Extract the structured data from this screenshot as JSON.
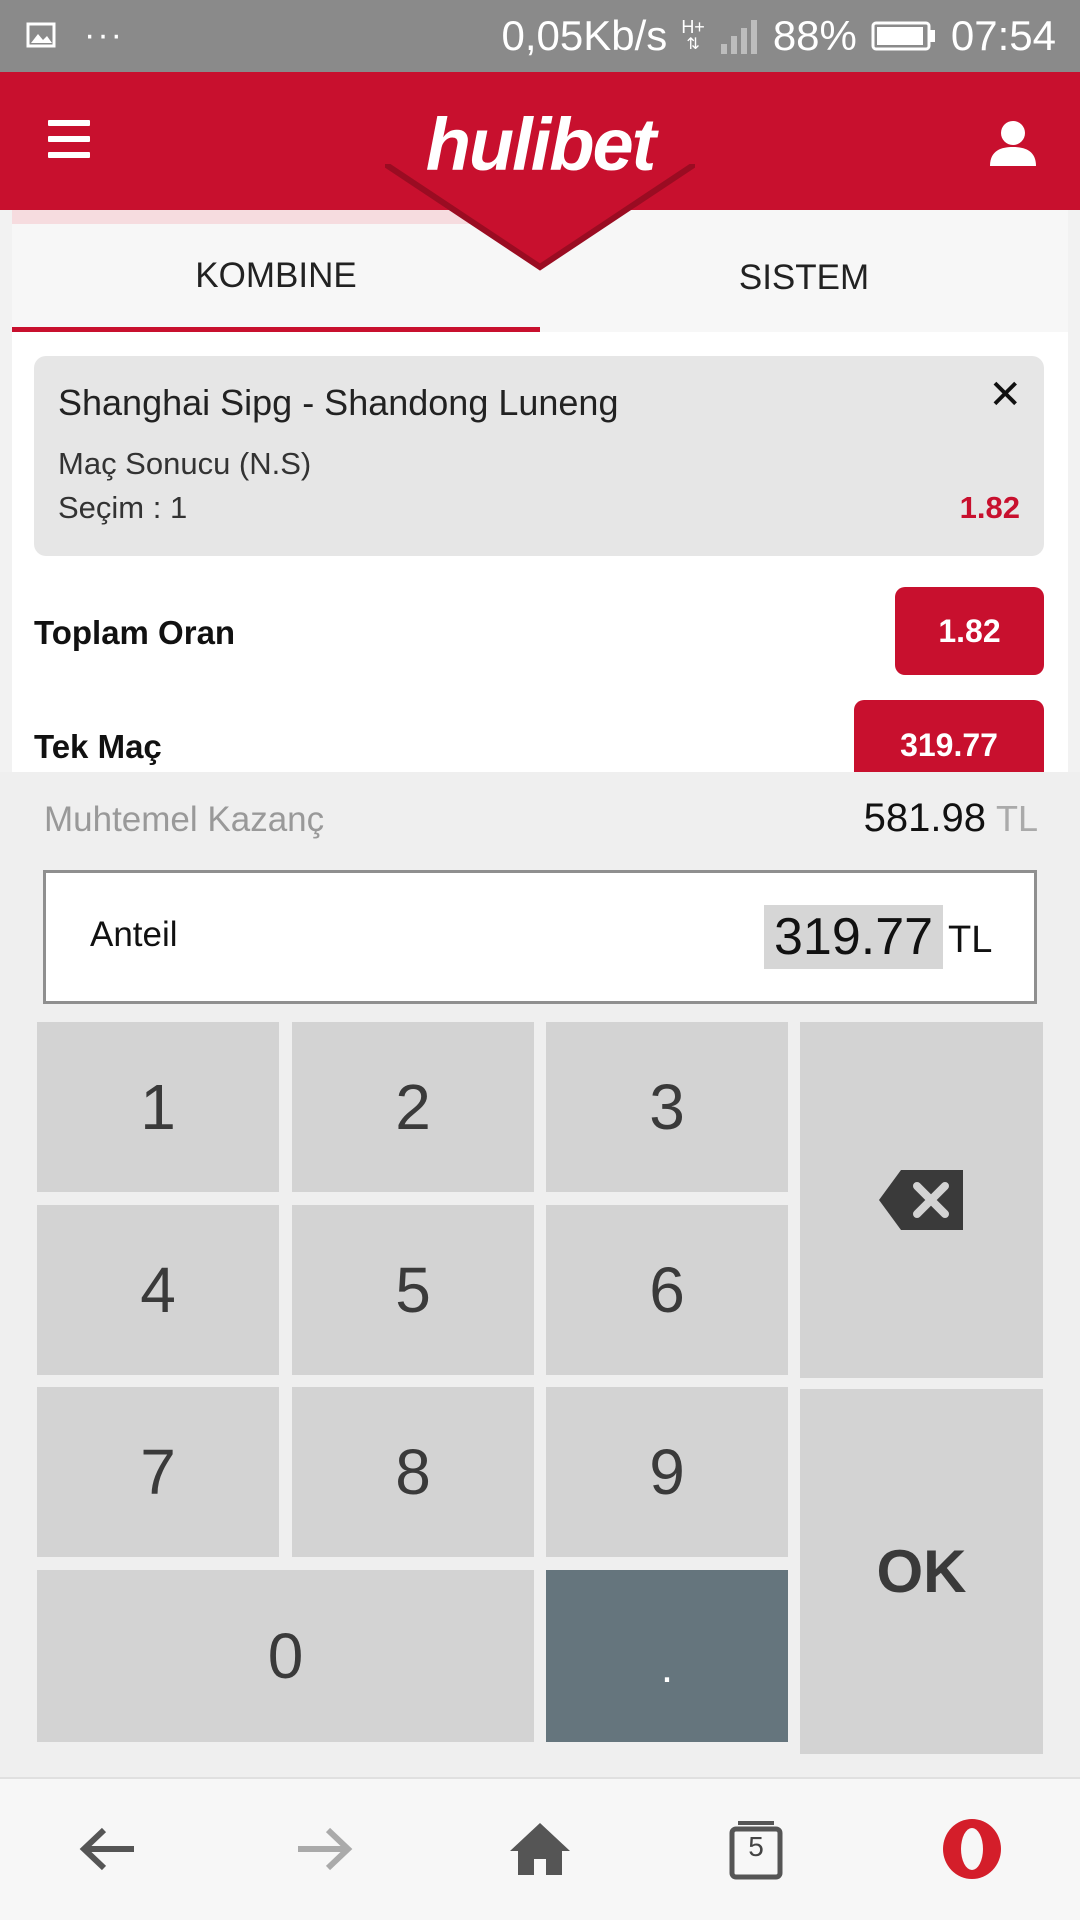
{
  "status_bar": {
    "speed": "0,05Kb/s",
    "network": "H+",
    "battery": "88%",
    "time": "07:54",
    "icons": [
      "image-icon",
      "more-dots-icon",
      "signal-icon",
      "battery-icon"
    ]
  },
  "header": {
    "logo": "hulibet",
    "menu_icon": "hamburger-menu-icon",
    "user_icon": "user-icon",
    "brand_color": "#c8102e"
  },
  "tabs": [
    {
      "label": "KOMBINE",
      "active": true
    },
    {
      "label": "SISTEM",
      "active": false
    }
  ],
  "bet": {
    "match": "Shanghai Sipg - Shandong Luneng",
    "market": "Maç Sonucu (N.S)",
    "selection": "Seçim : 1",
    "odd": "1.82"
  },
  "summary": {
    "total_odds_label": "Toplam Oran",
    "total_odds_value": "1.82",
    "single_label": "Tek Maç",
    "single_value": "319.77"
  },
  "winnings": {
    "label": "Muhtemel Kazanç",
    "value": "581.98",
    "currency": "TL"
  },
  "stake": {
    "label": "Anteil",
    "value": "319.77",
    "currency": "TL"
  },
  "keypad": {
    "keys": [
      "1",
      "2",
      "3",
      "4",
      "5",
      "6",
      "7",
      "8",
      "9",
      "0",
      "."
    ],
    "ok": "OK",
    "backspace_icon": "backspace-icon"
  },
  "browser_nav": {
    "tabs_count": "5",
    "icons": [
      "back-arrow-icon",
      "forward-arrow-icon",
      "home-icon",
      "tabs-icon",
      "opera-logo-icon"
    ]
  }
}
